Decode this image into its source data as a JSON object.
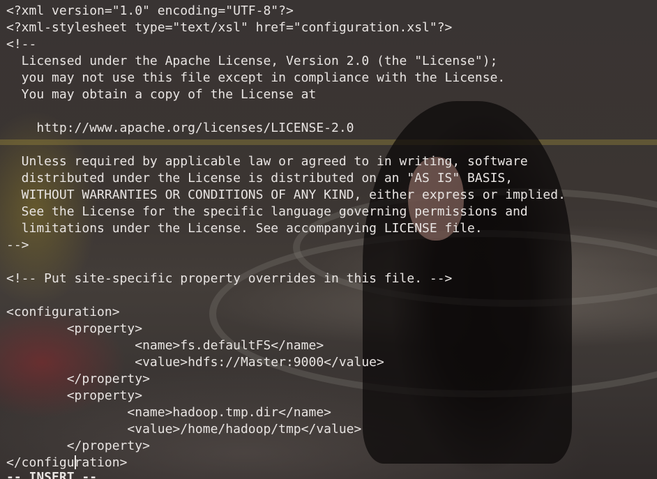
{
  "editor": {
    "lines": [
      "<?xml version=\"1.0\" encoding=\"UTF-8\"?>",
      "<?xml-stylesheet type=\"text/xsl\" href=\"configuration.xsl\"?>",
      "<!--",
      "  Licensed under the Apache License, Version 2.0 (the \"License\");",
      "  you may not use this file except in compliance with the License.",
      "  You may obtain a copy of the License at",
      "",
      "    http://www.apache.org/licenses/LICENSE-2.0",
      "",
      "  Unless required by applicable law or agreed to in writing, software",
      "  distributed under the License is distributed on an \"AS IS\" BASIS,",
      "  WITHOUT WARRANTIES OR CONDITIONS OF ANY KIND, either express or implied.",
      "  See the License for the specific language governing permissions and",
      "  limitations under the License. See accompanying LICENSE file.",
      "-->",
      "",
      "<!-- Put site-specific property overrides in this file. -->",
      "",
      "<configuration>",
      "        <property>",
      "                 <name>fs.defaultFS</name>",
      "                 <value>hdfs://Master:9000</value>",
      "        </property>",
      "        <property>",
      "                <name>hadoop.tmp.dir</name>",
      "                <value>/home/hadoop/tmp</value>",
      "        </property>",
      "</configuration>"
    ],
    "cursor_line": 27,
    "cursor_col": 9,
    "mode": "-- INSERT --"
  },
  "colors": {
    "text": "#e8e4e2",
    "background": "#393433",
    "cursor": "#f0ecea"
  }
}
